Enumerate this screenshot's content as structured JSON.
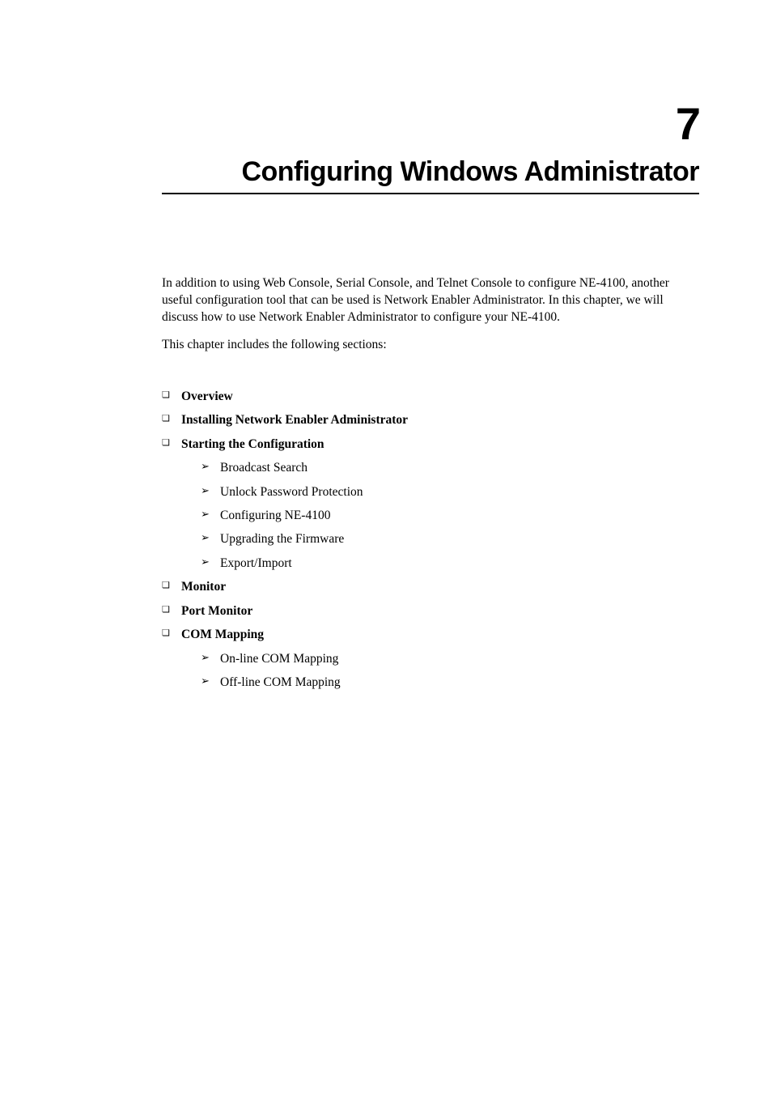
{
  "chapter": {
    "number": "7",
    "title": "Configuring Windows Administrator"
  },
  "intro": {
    "paragraph": "In addition to using Web Console, Serial Console, and Telnet Console to configure NE-4100, another useful configuration tool that can be used is Network Enabler Administrator. In this chapter, we will discuss how to use Network Enabler Administrator to configure your NE-4100.",
    "sections_intro": "This chapter includes the following sections:"
  },
  "toc": [
    {
      "level": 1,
      "label": "Overview"
    },
    {
      "level": 1,
      "label": "Installing Network Enabler Administrator"
    },
    {
      "level": 1,
      "label": "Starting the Configuration"
    },
    {
      "level": 2,
      "label": "Broadcast Search"
    },
    {
      "level": 2,
      "label": "Unlock Password Protection"
    },
    {
      "level": 2,
      "label": "Configuring NE-4100"
    },
    {
      "level": 2,
      "label": "Upgrading the Firmware"
    },
    {
      "level": 2,
      "label": "Export/Import"
    },
    {
      "level": 1,
      "label": "Monitor"
    },
    {
      "level": 1,
      "label": "Port Monitor"
    },
    {
      "level": 1,
      "label": "COM Mapping"
    },
    {
      "level": 2,
      "label": "On-line COM Mapping"
    },
    {
      "level": 2,
      "label": "Off-line COM Mapping"
    }
  ]
}
